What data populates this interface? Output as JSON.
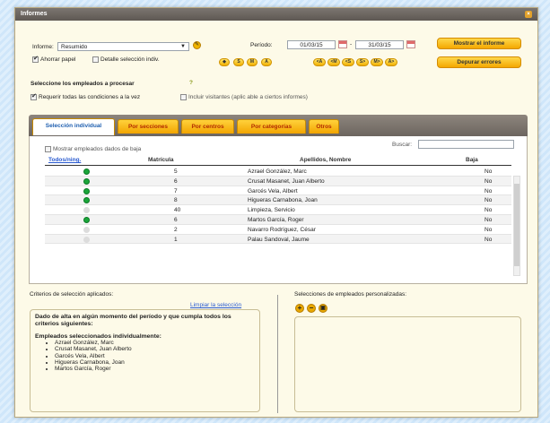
{
  "window": {
    "title": "Informes"
  },
  "form": {
    "informe_label": "Informe:",
    "informe_value": "Resumido",
    "ahorrar_papel": "Ahorrar papel",
    "detalle": "Detalle selección indiv.",
    "periodo_label": "Período:",
    "date_from": "01/03/15",
    "date_sep": "-",
    "date_to": "31/03/15",
    "left_pills": [
      "◆",
      "S",
      "M",
      "A"
    ],
    "right_pills": [
      "<A",
      "<M",
      "<S",
      "S>",
      "M>",
      "A>"
    ],
    "mostrar_btn": "Mostrar el informe",
    "depurar_btn": "Depurar errores"
  },
  "selection": {
    "heading": "Seleccione los empleados a procesar",
    "help": "?",
    "requerir": "Requerir todas las condiciones a la vez",
    "incluir": "Incluir visitantes (aplic able a ciertos informes)"
  },
  "tabs": [
    "Selección individual",
    "Por secciones",
    "Por centros",
    "Por categorías",
    "Otros"
  ],
  "table": {
    "mostrar_baja": "Mostrar empleados dados de baja",
    "buscar": "Buscar:",
    "col_todos": "Todos/ning.",
    "col_matricula": "Matrícula",
    "col_nombre": "Apellidos, Nombre",
    "col_baja": "Baja",
    "rows": [
      {
        "sel": true,
        "mat": "5",
        "nombre": "Azrael González, Marc",
        "baja": "No"
      },
      {
        "sel": true,
        "mat": "6",
        "nombre": "Crusat Masanet, Juan Alberto",
        "baja": "No"
      },
      {
        "sel": true,
        "mat": "7",
        "nombre": "Garcés Vela, Albert",
        "baja": "No"
      },
      {
        "sel": true,
        "mat": "8",
        "nombre": "Higueras Carnabona, Joan",
        "baja": "No"
      },
      {
        "sel": false,
        "mat": "40",
        "nombre": "Limpieza, Servicio",
        "baja": "No"
      },
      {
        "sel": true,
        "mat": "6",
        "nombre": "Martos García, Roger",
        "baja": "No"
      },
      {
        "sel": false,
        "mat": "2",
        "nombre": "Navarro Rodríguez, César",
        "baja": "No"
      },
      {
        "sel": false,
        "mat": "1",
        "nombre": "Palau Sandoval, Jaume",
        "baja": "No"
      }
    ]
  },
  "criterios": {
    "label": "Criterios de selección aplicados:",
    "limpiar": "Limpiar la selección",
    "line1": "Dado de alta en algún momento del período y que cumpla todos los criterios siguientes:",
    "line2": "Empleados seleccionados individualmente:",
    "items": [
      "Azrael González, Marc",
      "Crusat Masanet, Juan Alberto",
      "Garcés Vela, Albert",
      "Higueras Carnabona, Joan",
      "Martos García, Roger"
    ]
  },
  "personalizadas": {
    "label": "Selecciones de empleados personalizadas:",
    "buttons": [
      "+",
      "−",
      "▣"
    ]
  },
  "colors": {
    "accent": "#f4a800",
    "selected": "#1aa63a",
    "tab_text": "#b22a00"
  }
}
